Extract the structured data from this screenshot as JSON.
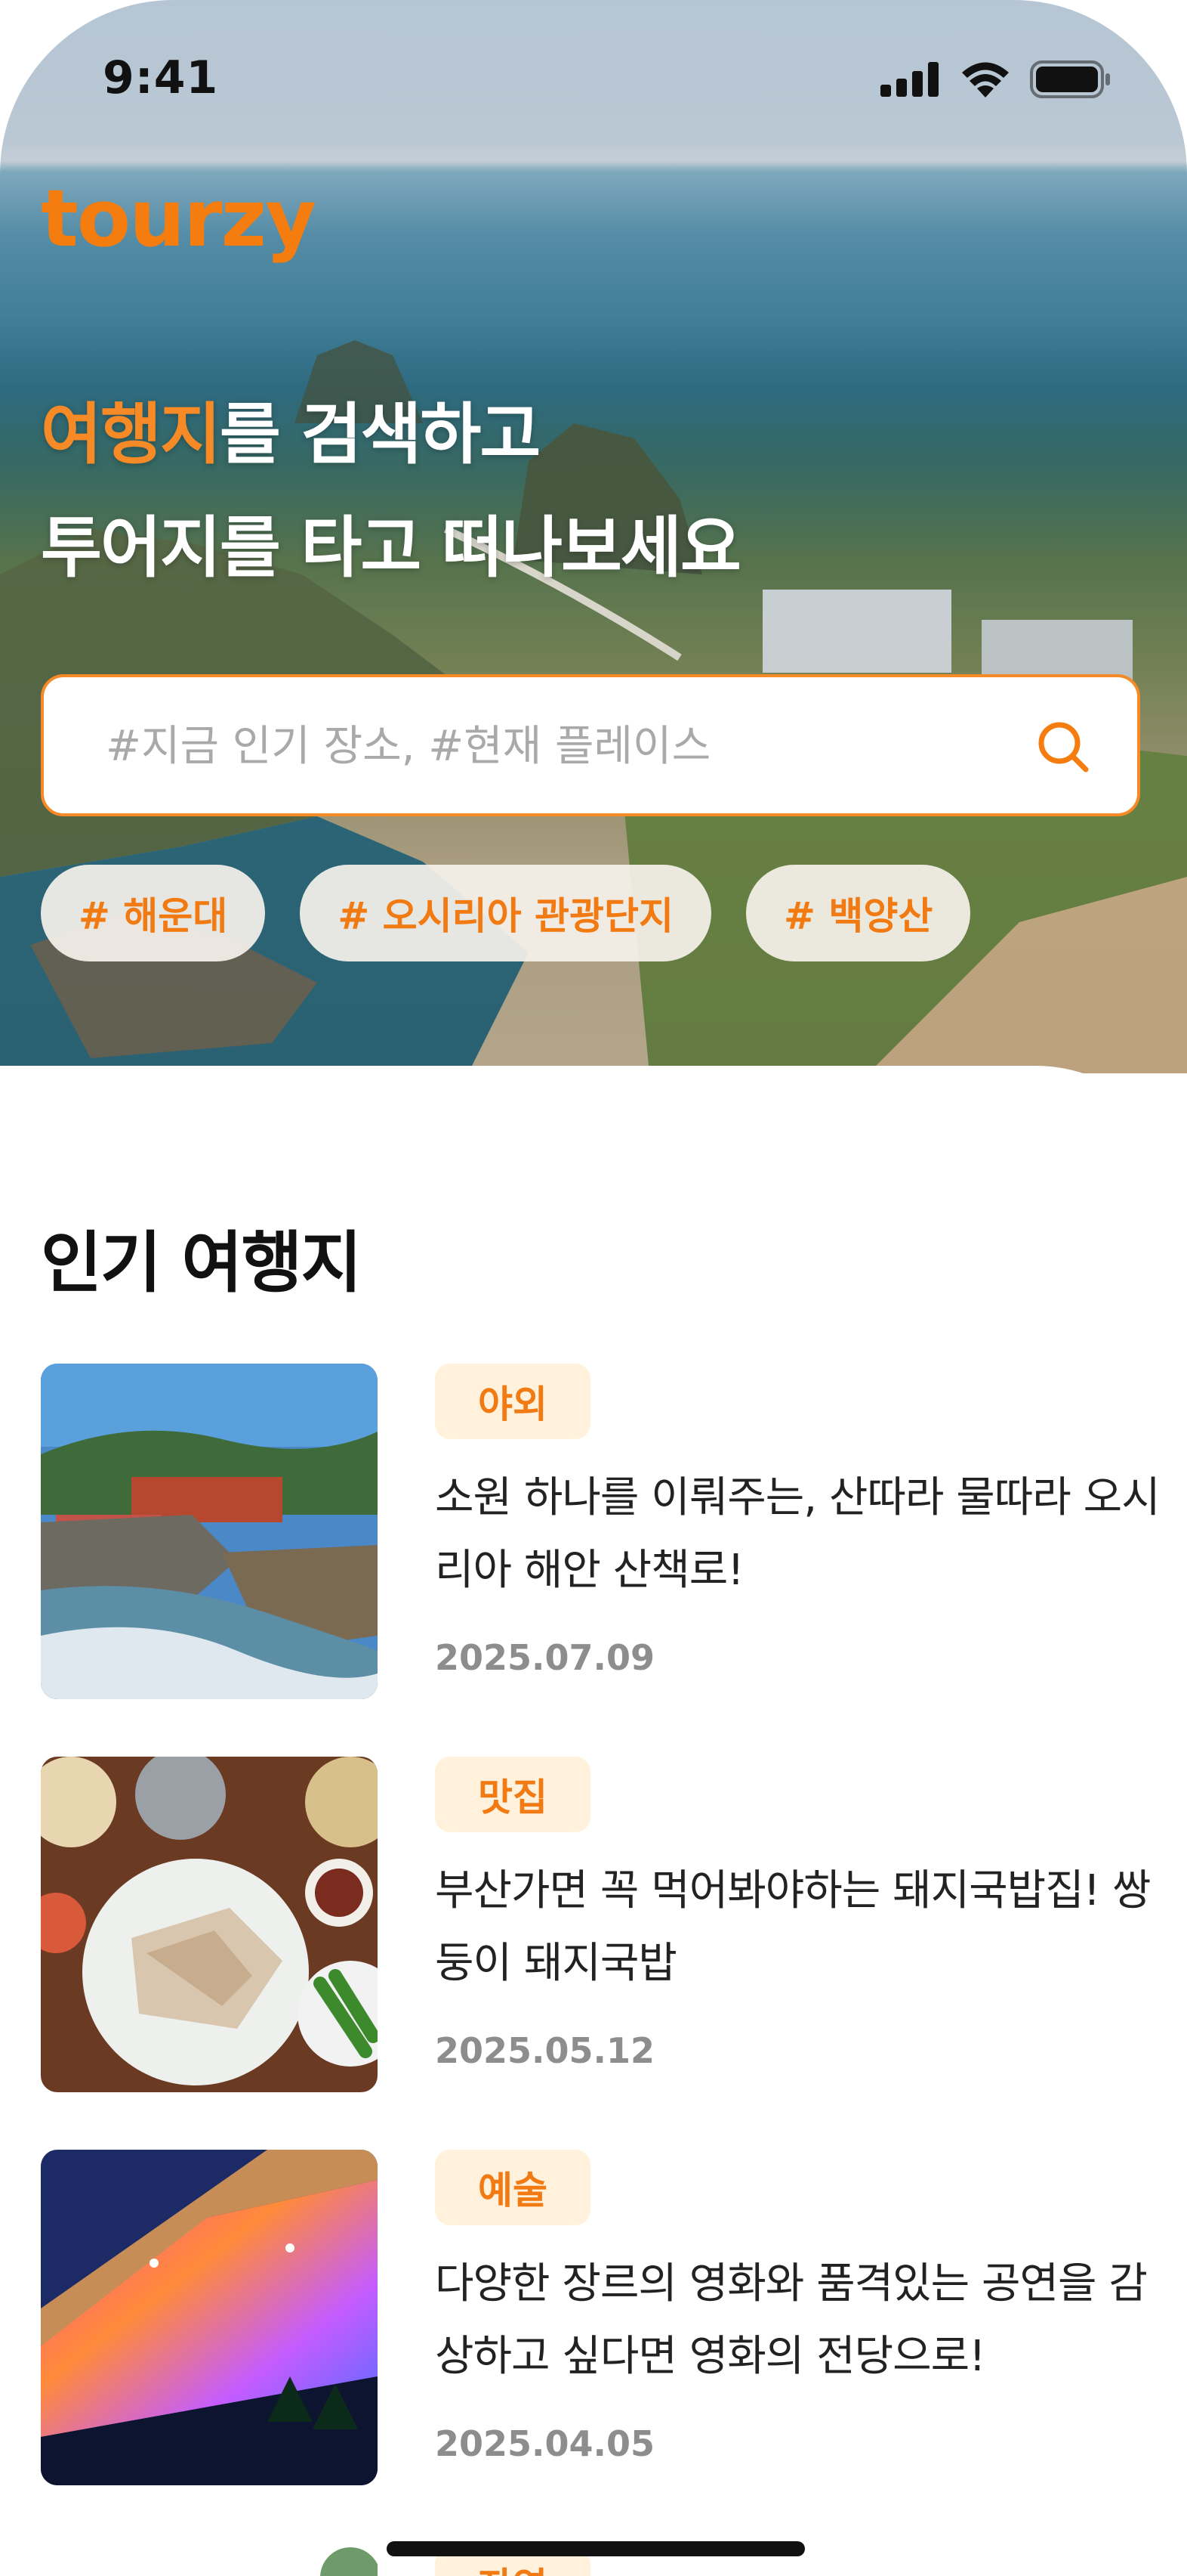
{
  "status_bar": {
    "time": "9:41"
  },
  "header": {
    "logo": "tourzy"
  },
  "hero": {
    "headline_accent": "여행지",
    "headline_rest": "를 검색하고",
    "headline_line2": "투어지를 타고 떠나보세요"
  },
  "search": {
    "placeholder": "#지금 인기 장소, #현재 플레이스"
  },
  "tags": [
    "# 해운대",
    "# 오시리아 관광단지",
    "# 백양산"
  ],
  "section": {
    "title": "인기 여행지"
  },
  "posts": [
    {
      "category": "야외",
      "title": "소원 하나를 이뤄주는, 산따라 물따라 오시리아 해안 산책로!",
      "date": "2025.07.09"
    },
    {
      "category": "맛집",
      "title": "부산가면 꼭 먹어봐야하는 돼지국밥집! 쌍둥이 돼지국밥",
      "date": "2025.05.12"
    },
    {
      "category": "예술",
      "title": "다양한 장르의 영화와 품격있는 공연을 감상하고 싶다면 영화의 전당으로!",
      "date": "2025.04.05"
    }
  ],
  "peek_post": {
    "category": "자연"
  },
  "colors": {
    "accent": "#f58a27",
    "badge_bg": "#fff1dc",
    "date": "#8d8d8d"
  },
  "icons": [
    "signal-icon",
    "wifi-icon",
    "battery-icon",
    "search-icon"
  ]
}
